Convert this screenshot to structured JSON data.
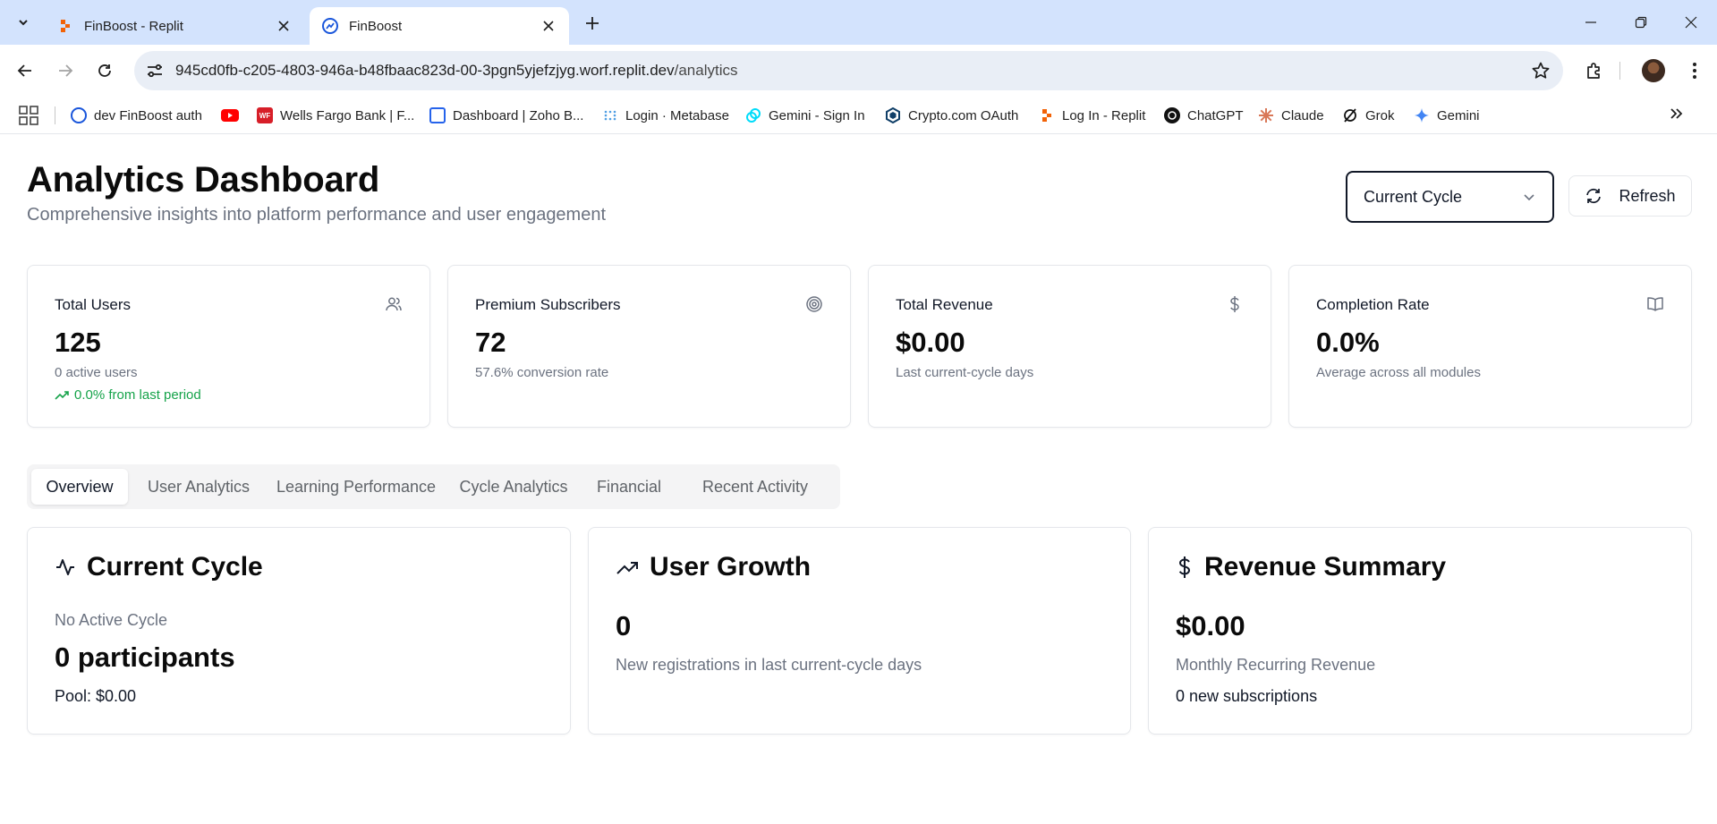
{
  "browser": {
    "tabs": [
      {
        "title": "FinBoost - Replit",
        "active": false
      },
      {
        "title": "FinBoost",
        "active": true
      }
    ],
    "url_host": "945cd0fb-c205-4803-946a-b48fbaac823d-00-3pgn5yjefzjyg.worf.replit.dev",
    "url_path": "/analytics",
    "bookmarks": [
      {
        "label": "dev FinBoost auth",
        "icon": "globe-icon"
      },
      {
        "label": "",
        "icon": "youtube-icon"
      },
      {
        "label": "Wells Fargo Bank | F...",
        "icon": "wellsfargo-icon"
      },
      {
        "label": "Dashboard | Zoho B...",
        "icon": "zoho-icon"
      },
      {
        "label": "Login · Metabase",
        "icon": "metabase-icon"
      },
      {
        "label": "Gemini - Sign In",
        "icon": "gemini-exchange-icon"
      },
      {
        "label": "Crypto.com OAuth",
        "icon": "crypto-icon"
      },
      {
        "label": "Log In - Replit",
        "icon": "replit-icon"
      },
      {
        "label": "ChatGPT",
        "icon": "chatgpt-icon"
      },
      {
        "label": "Claude",
        "icon": "claude-icon"
      },
      {
        "label": "Grok",
        "icon": "grok-icon"
      },
      {
        "label": "Gemini",
        "icon": "gemini-icon"
      }
    ]
  },
  "header": {
    "title": "Analytics Dashboard",
    "subtitle": "Comprehensive insights into platform performance and user engagement",
    "period_select": "Current Cycle",
    "refresh_label": "Refresh"
  },
  "stats": [
    {
      "label": "Total Users",
      "value": "125",
      "desc": "0 active users",
      "trend": "0.0% from last period",
      "icon": "users-icon"
    },
    {
      "label": "Premium Subscribers",
      "value": "72",
      "desc": "57.6% conversion rate",
      "icon": "target-icon"
    },
    {
      "label": "Total Revenue",
      "value": "$0.00",
      "desc": "Last current-cycle days",
      "icon": "dollar-icon"
    },
    {
      "label": "Completion Rate",
      "value": "0.0%",
      "desc": "Average across all modules",
      "icon": "book-icon"
    }
  ],
  "tabs": [
    "Overview",
    "User Analytics",
    "Learning Performance",
    "Cycle Analytics",
    "Financial",
    "Recent Activity"
  ],
  "cards": {
    "cycle": {
      "title": "Current Cycle",
      "status": "No Active Cycle",
      "participants": "0 participants",
      "pool": "Pool: $0.00"
    },
    "growth": {
      "title": "User Growth",
      "value": "0",
      "desc": "New registrations in last current-cycle days"
    },
    "revenue": {
      "title": "Revenue Summary",
      "value": "$0.00",
      "desc": "Monthly Recurring Revenue",
      "subs": "0 new subscriptions"
    }
  },
  "colors": {
    "accent_green": "#16a34a",
    "tabstrip": "#d3e3fd",
    "text_muted": "#6b7280"
  }
}
